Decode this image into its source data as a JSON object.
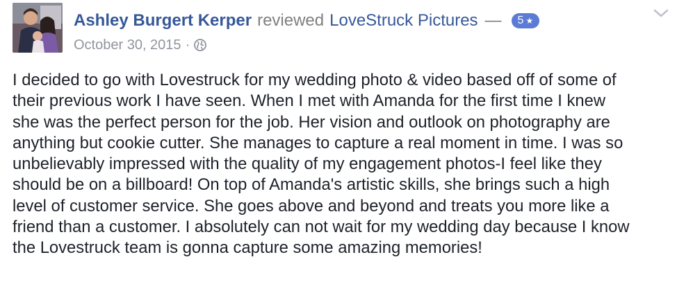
{
  "post": {
    "author": "Ashley Burgert Kerper",
    "verb": "reviewed",
    "page_name": "LoveStruck Pictures",
    "dash": "—",
    "rating": "5",
    "date": "October 30, 2015",
    "separator": "·",
    "privacy_icon": "globe-icon",
    "menu_icon": "chevron-down-icon",
    "avatar": "avatar-photo",
    "review_lines": [
      "I decided to go with Lovestruck for my wedding photo & video based off of some of",
      "their previous work I have seen. When I met with Amanda for the first time I knew",
      "she was the perfect person for the job. Her vision and outlook on photography are",
      "anything but cookie cutter. She manages to capture a real moment in time. I was so",
      "unbelievably impressed with the quality of my engagement photos-I feel like they",
      "should be on a billboard! On top of Amanda's artistic skills, she brings such a high",
      "level of customer service. She goes above and beyond and treats you more like a",
      "friend than a customer. I absolutely can not wait for my wedding day because I know",
      "the Lovestruck team is gonna capture some amazing memories!"
    ]
  },
  "colors": {
    "link": "#365899",
    "muted": "#90949c",
    "body_text": "#1d2129",
    "badge": "#5b7bd5"
  }
}
